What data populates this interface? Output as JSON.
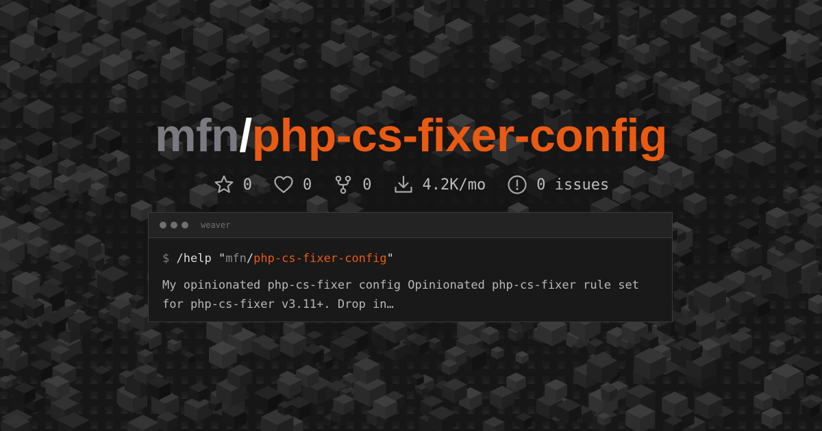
{
  "title": {
    "owner": "mfn",
    "separator": "/",
    "repo": "php-cs-fixer-config"
  },
  "stats": [
    {
      "icon": "star-icon",
      "value": "0"
    },
    {
      "icon": "heart-icon",
      "value": "0"
    },
    {
      "icon": "fork-icon",
      "value": "0"
    },
    {
      "icon": "download-icon",
      "value": "4.2K/mo"
    },
    {
      "icon": "issue-icon",
      "value": "0 issues"
    }
  ],
  "terminal": {
    "window_title": "weaver",
    "prompt": "$",
    "command": "/help",
    "quote_open": "\"",
    "arg_owner": "mfn",
    "arg_separator": "/",
    "arg_repo": "php-cs-fixer-config",
    "quote_close": "\"",
    "description": "My opinionated php-cs-fixer config Opinionated php-cs-fixer rule set for php-cs-fixer v3.11+. Drop in…"
  },
  "colors": {
    "accent": "#ea5a13",
    "owner": "#7a7a80",
    "background": "#141414"
  }
}
